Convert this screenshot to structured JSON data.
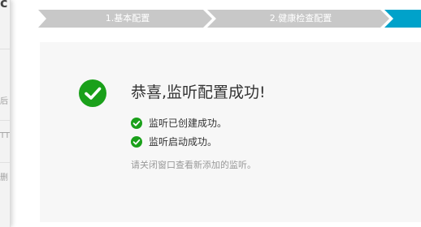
{
  "steps": [
    {
      "label": "1.基本配置",
      "state": "done"
    },
    {
      "label": "2.健康检查配置",
      "state": "done"
    },
    {
      "label": "",
      "state": "active"
    }
  ],
  "colors": {
    "step_done": "#c8c8c8",
    "step_active": "#00a2ca",
    "success_green": "#1aa01a",
    "panel_bg": "#f7f7f7"
  },
  "result": {
    "title": "恭喜,监听配置成功!",
    "icon": "success-check-icon",
    "items": [
      {
        "text": "监听已创建成功。",
        "icon": "check-circle-icon"
      },
      {
        "text": "监听启动成功。",
        "icon": "check-circle-icon"
      }
    ],
    "hint": "请关闭窗口查看新添加的监听。"
  }
}
